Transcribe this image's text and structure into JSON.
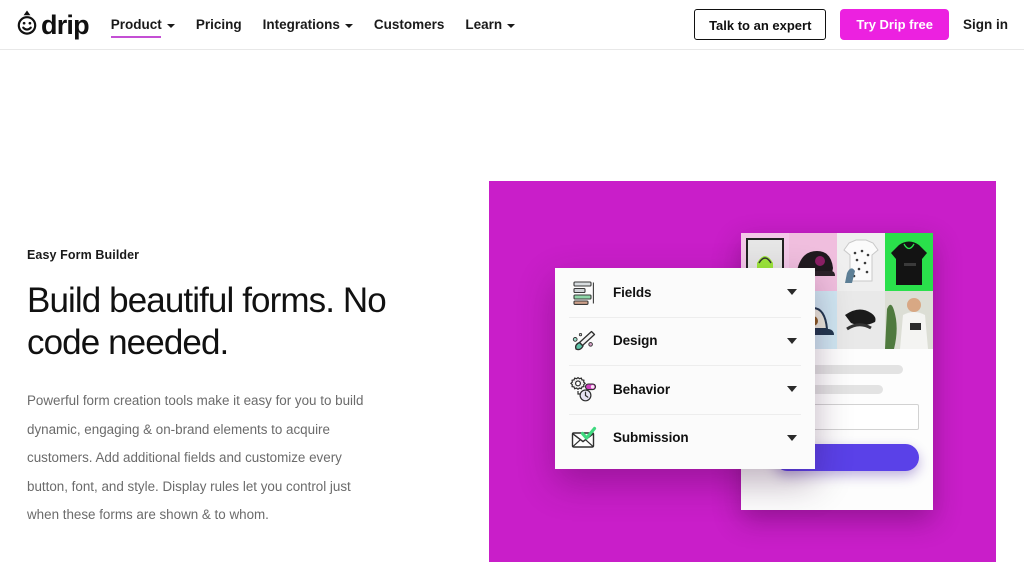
{
  "nav": {
    "brand": {
      "name": "drip",
      "logo_icon": "drip-smiley-logo"
    },
    "links": [
      {
        "label": "Product",
        "has_caret": true,
        "active": true
      },
      {
        "label": "Pricing",
        "has_caret": false,
        "active": false
      },
      {
        "label": "Integrations",
        "has_caret": true,
        "active": false
      },
      {
        "label": "Customers",
        "has_caret": false,
        "active": false
      },
      {
        "label": "Learn",
        "has_caret": true,
        "active": false
      }
    ],
    "talk_to_expert": "Talk to an expert",
    "try_free": "Try Drip free",
    "sign_in": "Sign in",
    "active_underline_color": "#c44fd4",
    "cta_color": "#ec21e0"
  },
  "hero": {
    "eyebrow": "Easy Form Builder",
    "headline": "Build beautiful forms. No code needed.",
    "blurb": "Powerful form creation tools make it easy for you to build dynamic, engaging & on-brand elements to acquire customers. Add additional fields and customize every button, font, and style. Display rules let you control just when these forms are shown & to whom."
  },
  "visual": {
    "background_color": "#c91ec9",
    "accordion": [
      {
        "label": "Fields",
        "icon": "form-fields-icon",
        "caret": "chevron-down-icon"
      },
      {
        "label": "Design",
        "icon": "paintbrush-icon",
        "caret": "chevron-down-icon"
      },
      {
        "label": "Behavior",
        "icon": "gear-toggle-clock-icon",
        "caret": "chevron-down-icon"
      },
      {
        "label": "Submission",
        "icon": "envelope-check-icon",
        "caret": "chevron-down-icon"
      }
    ],
    "mock_form": {
      "cta_color": "#5a41e8",
      "photo_tiles": [
        {
          "name": "green-tote-bag-photo",
          "bg": "#f3c8e8"
        },
        {
          "name": "black-cap-photo",
          "bg": "#f0bede"
        },
        {
          "name": "patterned-tshirt-photo",
          "bg": "#ededed"
        },
        {
          "name": "black-hoodie-photo",
          "bg": "#2ae04b"
        },
        {
          "name": "pineapple-photo",
          "bg": "#f0b27a"
        },
        {
          "name": "navy-cap-photo",
          "bg": "#cfe6f2"
        },
        {
          "name": "model-tshirt-photo",
          "bg": "#d9dcd2"
        },
        {
          "name": "accessory-photo",
          "bg": "#e8e8e8"
        }
      ]
    }
  }
}
